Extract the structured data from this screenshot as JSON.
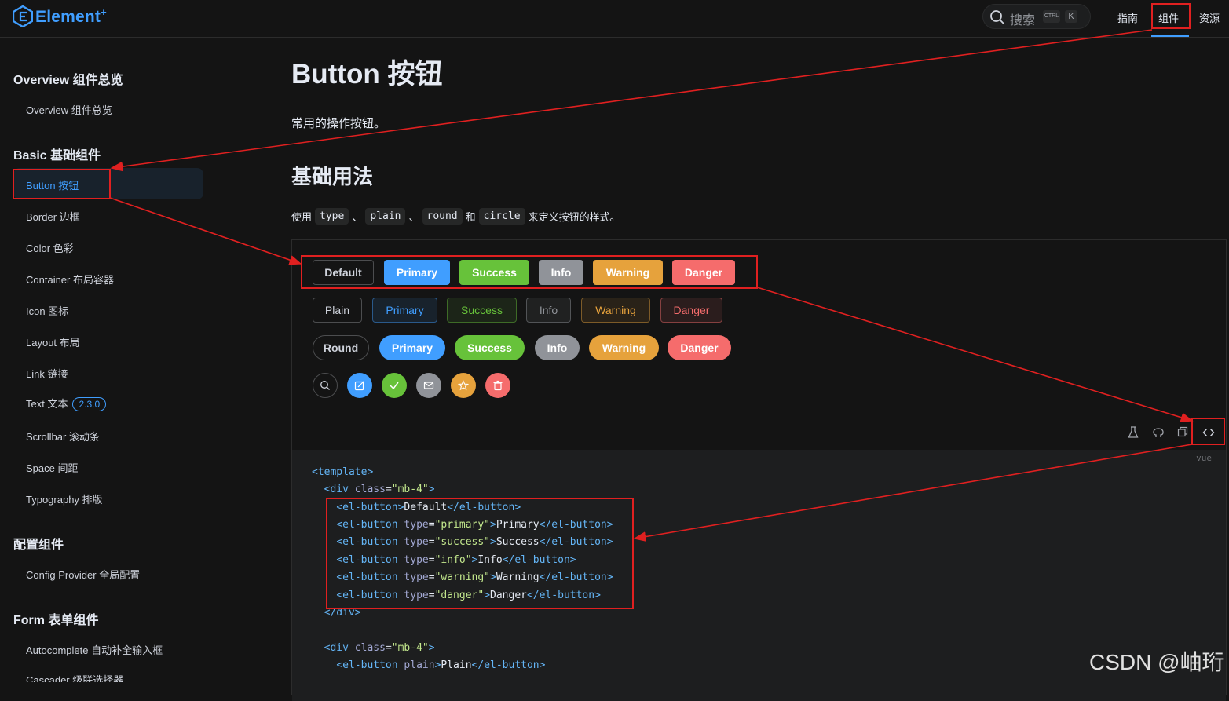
{
  "header": {
    "logo_text": "Element",
    "logo_plus": "+",
    "search_placeholder": "搜索",
    "search_kbd_ctrl": "CTRL",
    "search_kbd_k": "K",
    "nav": {
      "guide": "指南",
      "component": "组件",
      "resource": "资源"
    }
  },
  "sidebar": {
    "groups": {
      "overview": "Overview 组件总览",
      "basic": "Basic 基础组件",
      "config": "配置组件",
      "form": "Form 表单组件"
    },
    "items": {
      "overview": "Overview 组件总览",
      "button": "Button 按钮",
      "border": "Border 边框",
      "color": "Color 色彩",
      "container": "Container 布局容器",
      "icon": "Icon 图标",
      "layout": "Layout 布局",
      "link": "Link 链接",
      "text": "Text 文本",
      "text_badge": "2.3.0",
      "scrollbar": "Scrollbar 滚动条",
      "space": "Space 间距",
      "typography": "Typography 排版",
      "config_provider": "Config Provider 全局配置",
      "autocomplete": "Autocomplete 自动补全输入框",
      "cascader": "Cascader 级联选择器"
    }
  },
  "main": {
    "title": "Button 按钮",
    "description": "常用的操作按钮。",
    "section_title": "基础用法",
    "usage": {
      "prefix": "使用",
      "code1": "type",
      "sep1": "、",
      "code2": "plain",
      "sep2": "、",
      "code3": "round",
      "and": "和",
      "code4": "circle",
      "suffix": "来定义按钮的样式。"
    }
  },
  "demo": {
    "row1": [
      "Default",
      "Primary",
      "Success",
      "Info",
      "Warning",
      "Danger"
    ],
    "row2": [
      "Plain",
      "Primary",
      "Success",
      "Info",
      "Warning",
      "Danger"
    ],
    "row3": [
      "Round",
      "Primary",
      "Success",
      "Info",
      "Warning",
      "Danger"
    ],
    "circle_icons": [
      "search-icon",
      "edit-icon",
      "check-icon",
      "message-icon",
      "star-icon",
      "delete-icon"
    ],
    "lang": "vue"
  },
  "code": {
    "l1": "<template>",
    "l2_open": "<div",
    "l2_attr": "class",
    "l2_val": "\"mb-4\"",
    "l3": "Default",
    "l4": "Primary",
    "l5": "Success",
    "l6": "Info",
    "l7": "Warning",
    "l8": "Danger",
    "types": [
      "\"primary\"",
      "\"success\"",
      "\"info\"",
      "\"warning\"",
      "\"danger\""
    ],
    "el_button": "el-button",
    "type_attr": "type",
    "plain_attr": "plain",
    "plain_text": "Plain",
    "close_div": "</div>"
  },
  "watermark": "CSDN @岫珩",
  "annotation_color": "#e02020"
}
